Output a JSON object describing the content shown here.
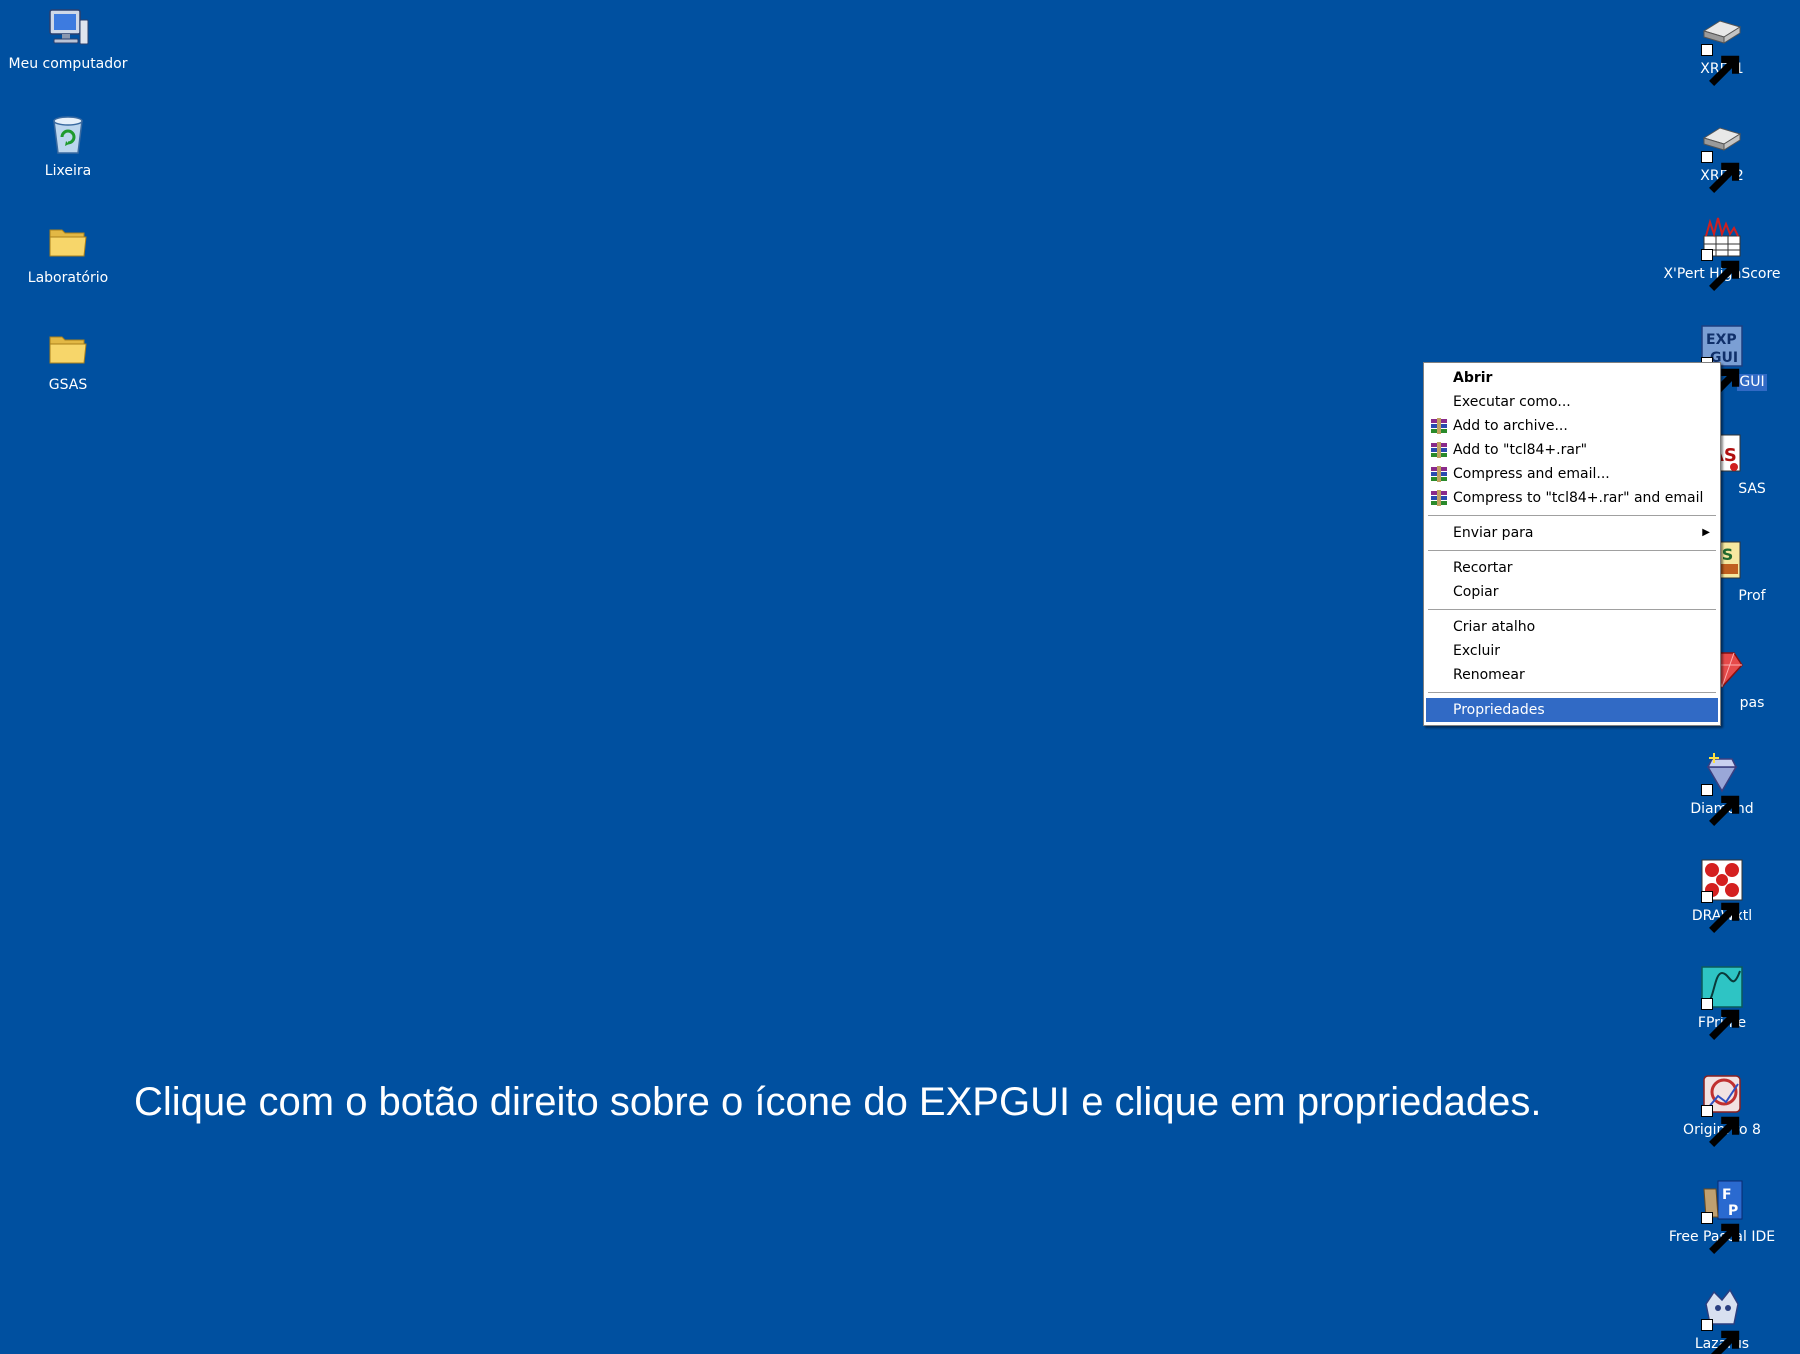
{
  "desktop": {
    "left_icons": [
      {
        "label": "Meu computador",
        "icon": "my-computer-icon"
      },
      {
        "label": "Lixeira",
        "icon": "recycle-bin-icon"
      },
      {
        "label": "Laboratório",
        "icon": "folder-icon"
      },
      {
        "label": "GSAS",
        "icon": "folder-icon"
      }
    ],
    "right_icons": [
      {
        "label": "XRD 1",
        "icon": "drive-icon"
      },
      {
        "label": "XRD 2",
        "icon": "drive-icon"
      },
      {
        "label": "X'Pert HighScore",
        "icon": "highscore-icon"
      },
      {
        "label": "GUI",
        "icon": "expgui-icon"
      },
      {
        "label": "SAS",
        "icon": "gsas-icon"
      },
      {
        "label": "Prof",
        "icon": "psprof-icon"
      },
      {
        "label": "pas",
        "icon": "ruby-icon"
      },
      {
        "label": "Diamond",
        "icon": "diamond-icon"
      },
      {
        "label": "DRAWxtl",
        "icon": "drawxtl-icon"
      },
      {
        "label": "FPrime",
        "icon": "fprime-icon"
      },
      {
        "label": "OriginPro 8",
        "icon": "originpro-icon"
      },
      {
        "label": "Free Pascal IDE",
        "icon": "freepascal-icon"
      },
      {
        "label": "Lazarus",
        "icon": "lazarus-icon"
      }
    ],
    "background_color": "#0050a0"
  },
  "context_menu": {
    "groups": [
      [
        {
          "label": "Abrir",
          "bold": true
        },
        {
          "label": "Executar como..."
        },
        {
          "label": "Add to archive...",
          "icon": "winrar-icon"
        },
        {
          "label": "Add to \"tcl84+.rar\"",
          "icon": "winrar-icon"
        },
        {
          "label": "Compress and email...",
          "icon": "winrar-icon"
        },
        {
          "label": "Compress to \"tcl84+.rar\" and email",
          "icon": "winrar-icon"
        }
      ],
      [
        {
          "label": "Enviar para",
          "submenu": true
        }
      ],
      [
        {
          "label": "Recortar"
        },
        {
          "label": "Copiar"
        }
      ],
      [
        {
          "label": "Criar atalho"
        },
        {
          "label": "Excluir"
        },
        {
          "label": "Renomear"
        }
      ],
      [
        {
          "label": "Propriedades",
          "highlighted": true
        }
      ]
    ],
    "highlight_color": "#316ac5"
  },
  "caption": "Clique com o botão direito sobre o ícone do EXPGUI e clique em propriedades."
}
